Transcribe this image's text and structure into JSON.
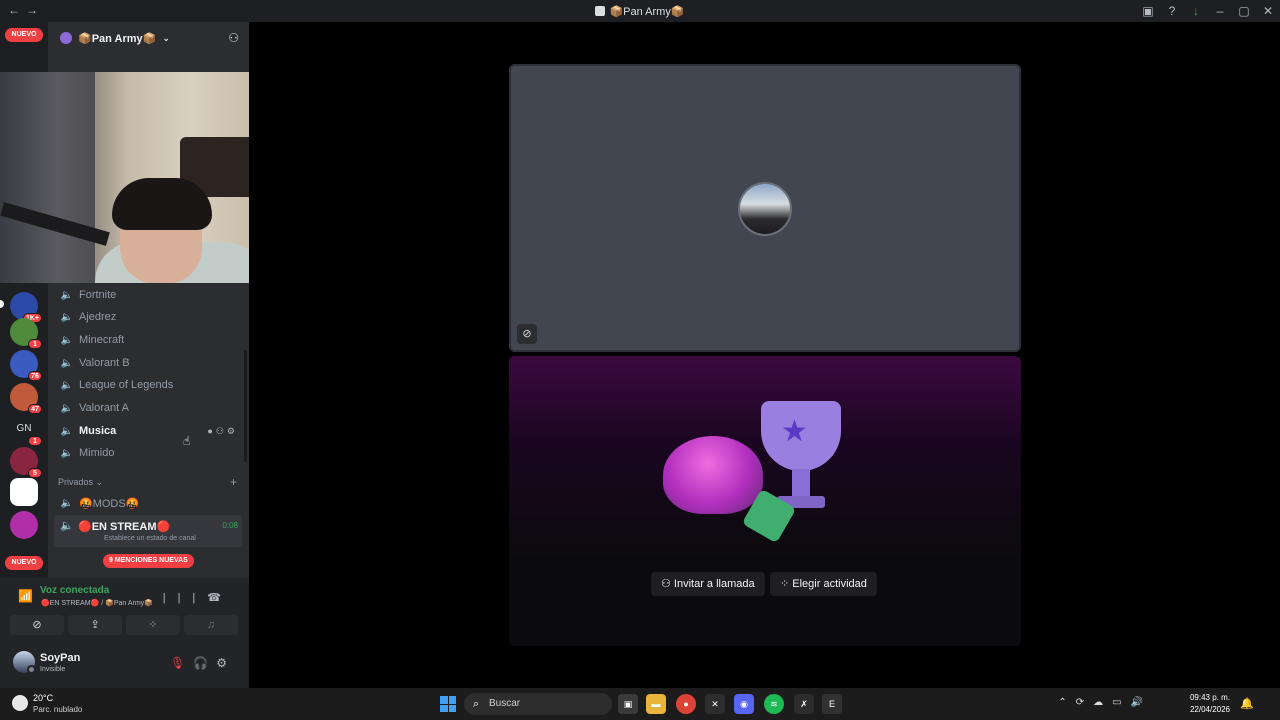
{
  "window": {
    "title": "📦Pan Army📦"
  },
  "colors": {
    "accent_green": "#3ba55d",
    "danger_red": "#f23f43",
    "background": "#2b2d31",
    "sidebar": "#1e1f22"
  },
  "servers": {
    "nuevo_top": "NUEVO",
    "nuevo_bottom": "NUEVO",
    "badges": [
      "1K+",
      "1",
      "76",
      "47",
      "1",
      "5"
    ],
    "gn_label": "GN"
  },
  "guild": {
    "name": "📦Pan Army📦"
  },
  "channels": [
    {
      "name": "Fortnite"
    },
    {
      "name": "Ajedrez"
    },
    {
      "name": "Minecraft"
    },
    {
      "name": "Valorant B"
    },
    {
      "name": "League of Legends"
    },
    {
      "name": "Valorant A"
    },
    {
      "name": "Musica"
    },
    {
      "name": "Mimido"
    }
  ],
  "category": {
    "name": "Privados"
  },
  "private_channels": {
    "mods": "🤬MODS🤬",
    "stream": "🔴EN STREAM🔴",
    "stream_timer": "0:08",
    "stream_status": "Establece un estado de canal"
  },
  "mentions_badge": "9 MENCIONES NUEVAS",
  "voice": {
    "title": "Voz conectada",
    "subtitle": "🔴EN STREAM🔴 / 📦Pan Army📦"
  },
  "user": {
    "name": "SoyPan",
    "status": "Invisible"
  },
  "stage": {
    "invite_label": "Invitar a llamada",
    "activity_label": "Elegir actividad"
  },
  "taskbar": {
    "temperature": "20°C",
    "weather": "Parc. nublado",
    "search_placeholder": "Buscar",
    "time": "09:43 p. m.",
    "date": "22/04/2026"
  }
}
